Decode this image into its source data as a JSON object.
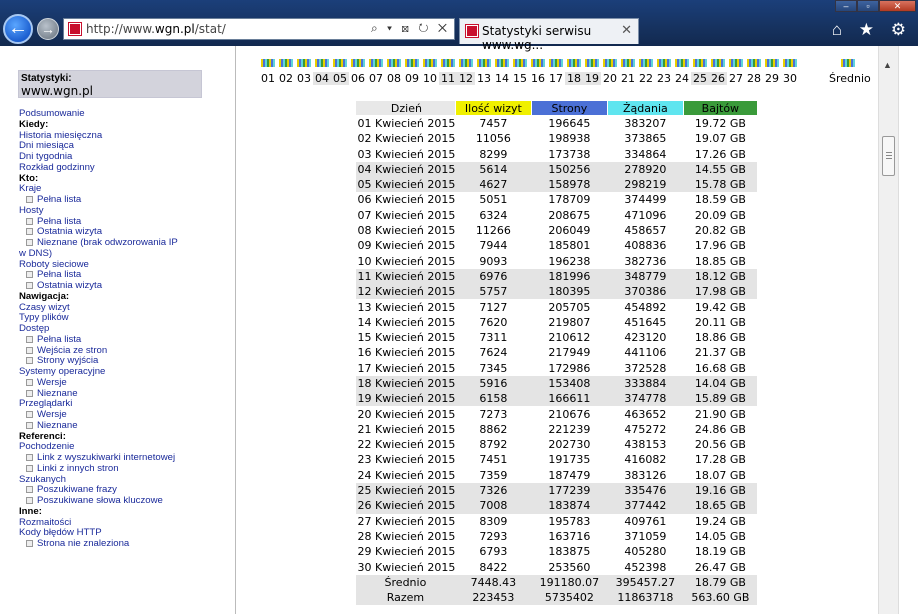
{
  "browser": {
    "url_prefix": "http://www.",
    "url_domain": "wgn.pl",
    "url_path": "/stat/",
    "address_controls": "⌕ ▾ ⊠ ↻ ✕",
    "tab_title": "Statystyki serwisu www.wg...",
    "tab_close": "✕",
    "toolbar_icons": "⌂ ★ ⚙",
    "colors": {
      "chrome": "#16325f",
      "back_button": "#1c5fd0"
    }
  },
  "sidebar": {
    "label": "Statystyki:",
    "site": "www.wgn.pl",
    "menu": [
      {
        "text": "Podsumowanie",
        "type": "link"
      },
      {
        "text": "Kiedy:",
        "type": "head"
      },
      {
        "text": "Historia miesięczna",
        "type": "link"
      },
      {
        "text": "Dni miesiąca",
        "type": "link"
      },
      {
        "text": "Dni tygodnia",
        "type": "link"
      },
      {
        "text": "Rozkład godzinny",
        "type": "link"
      },
      {
        "text": "Kto:",
        "type": "head"
      },
      {
        "text": "Kraje",
        "type": "link"
      },
      {
        "text": "Pełna lista",
        "type": "sub"
      },
      {
        "text": "Hosty",
        "type": "link"
      },
      {
        "text": "Pełna lista",
        "type": "sub"
      },
      {
        "text": "Ostatnia wizyta",
        "type": "sub"
      },
      {
        "text": "Nieznane (brak odwzorowania IP",
        "type": "sub"
      },
      {
        "text": "w DNS)",
        "type": "link"
      },
      {
        "text": "Roboty sieciowe",
        "type": "link"
      },
      {
        "text": "Pełna lista",
        "type": "sub"
      },
      {
        "text": "Ostatnia wizyta",
        "type": "sub"
      },
      {
        "text": "Nawigacja:",
        "type": "head"
      },
      {
        "text": "Czasy wizyt",
        "type": "link"
      },
      {
        "text": "Typy plików",
        "type": "link"
      },
      {
        "text": "Dostęp",
        "type": "link"
      },
      {
        "text": "Pełna lista",
        "type": "sub"
      },
      {
        "text": "Wejścia ze stron",
        "type": "sub"
      },
      {
        "text": "Strony wyjścia",
        "type": "sub"
      },
      {
        "text": "Systemy operacyjne",
        "type": "link"
      },
      {
        "text": "Wersje",
        "type": "sub"
      },
      {
        "text": "Nieznane",
        "type": "sub"
      },
      {
        "text": "Przeglądarki",
        "type": "link"
      },
      {
        "text": "Wersje",
        "type": "sub"
      },
      {
        "text": "Nieznane",
        "type": "sub"
      },
      {
        "text": "Referenci:",
        "type": "head"
      },
      {
        "text": "Pochodzenie",
        "type": "link"
      },
      {
        "text": "Link z wyszukiwarki internetowej",
        "type": "sub"
      },
      {
        "text": "Linki z innych stron",
        "type": "sub"
      },
      {
        "text": "Szukanych",
        "type": "link"
      },
      {
        "text": "Poszukiwane frazy",
        "type": "sub"
      },
      {
        "text": "Poszukiwane słowa kluczowe",
        "type": "sub"
      },
      {
        "text": "Inne:",
        "type": "head"
      },
      {
        "text": "Rozmaitości",
        "type": "link"
      },
      {
        "text": "Kody błędów HTTP",
        "type": "link"
      },
      {
        "text": "Strona nie znaleziona",
        "type": "sub"
      }
    ]
  },
  "days_bar": {
    "days": [
      "01",
      "02",
      "03",
      "04",
      "05",
      "06",
      "07",
      "08",
      "09",
      "10",
      "11",
      "12",
      "13",
      "14",
      "15",
      "16",
      "17",
      "18",
      "19",
      "20",
      "21",
      "22",
      "23",
      "24",
      "25",
      "26",
      "27",
      "28",
      "29",
      "30"
    ],
    "weekend_days": [
      "04",
      "05",
      "11",
      "12",
      "18",
      "19",
      "25",
      "26"
    ],
    "average_label": "Średnio"
  },
  "table": {
    "headers": [
      "Dzień",
      "Ilość wizyt",
      "Strony",
      "Żądania",
      "Bajtów"
    ],
    "header_colors": [
      "#e8e8e8",
      "#f0f000",
      "#4b70d6",
      "#5fe5ef",
      "#3a9a3a"
    ],
    "weekend_row_color": "#e4e4e4",
    "rows": [
      [
        "01 Kwiecień 2015",
        "7457",
        "196645",
        "383207",
        "19.72 GB"
      ],
      [
        "02 Kwiecień 2015",
        "11056",
        "198938",
        "373865",
        "19.07 GB"
      ],
      [
        "03 Kwiecień 2015",
        "8299",
        "173738",
        "334864",
        "17.26 GB"
      ],
      [
        "04 Kwiecień 2015",
        "5614",
        "150256",
        "278920",
        "14.55 GB"
      ],
      [
        "05 Kwiecień 2015",
        "4627",
        "158978",
        "298219",
        "15.78 GB"
      ],
      [
        "06 Kwiecień 2015",
        "5051",
        "178709",
        "374499",
        "18.59 GB"
      ],
      [
        "07 Kwiecień 2015",
        "6324",
        "208675",
        "471096",
        "20.09 GB"
      ],
      [
        "08 Kwiecień 2015",
        "11266",
        "206049",
        "458657",
        "20.82 GB"
      ],
      [
        "09 Kwiecień 2015",
        "7944",
        "185801",
        "408836",
        "17.96 GB"
      ],
      [
        "10 Kwiecień 2015",
        "9093",
        "196238",
        "382736",
        "18.85 GB"
      ],
      [
        "11 Kwiecień 2015",
        "6976",
        "181996",
        "348779",
        "18.12 GB"
      ],
      [
        "12 Kwiecień 2015",
        "5757",
        "180395",
        "370386",
        "17.98 GB"
      ],
      [
        "13 Kwiecień 2015",
        "7127",
        "205705",
        "454892",
        "19.42 GB"
      ],
      [
        "14 Kwiecień 2015",
        "7620",
        "219807",
        "451645",
        "20.11 GB"
      ],
      [
        "15 Kwiecień 2015",
        "7311",
        "210612",
        "423120",
        "18.86 GB"
      ],
      [
        "16 Kwiecień 2015",
        "7624",
        "217949",
        "441106",
        "21.37 GB"
      ],
      [
        "17 Kwiecień 2015",
        "7345",
        "172986",
        "372528",
        "16.68 GB"
      ],
      [
        "18 Kwiecień 2015",
        "5916",
        "153408",
        "333884",
        "14.04 GB"
      ],
      [
        "19 Kwiecień 2015",
        "6158",
        "166611",
        "374778",
        "15.89 GB"
      ],
      [
        "20 Kwiecień 2015",
        "7273",
        "210676",
        "463652",
        "21.90 GB"
      ],
      [
        "21 Kwiecień 2015",
        "8862",
        "221239",
        "475272",
        "24.86 GB"
      ],
      [
        "22 Kwiecień 2015",
        "8792",
        "202730",
        "438153",
        "20.56 GB"
      ],
      [
        "23 Kwiecień 2015",
        "7451",
        "191735",
        "416082",
        "17.28 GB"
      ],
      [
        "24 Kwiecień 2015",
        "7359",
        "187479",
        "383126",
        "18.07 GB"
      ],
      [
        "25 Kwiecień 2015",
        "7326",
        "177239",
        "335476",
        "19.16 GB"
      ],
      [
        "26 Kwiecień 2015",
        "7008",
        "183874",
        "377442",
        "18.65 GB"
      ],
      [
        "27 Kwiecień 2015",
        "8309",
        "195783",
        "409761",
        "19.24 GB"
      ],
      [
        "28 Kwiecień 2015",
        "7293",
        "163716",
        "371059",
        "14.05 GB"
      ],
      [
        "29 Kwiecień 2015",
        "6793",
        "183875",
        "405280",
        "18.19 GB"
      ],
      [
        "30 Kwiecień 2015",
        "8422",
        "253560",
        "452398",
        "26.47 GB"
      ]
    ],
    "weekend_rows": [
      3,
      4,
      10,
      11,
      17,
      18,
      24,
      25
    ],
    "average": [
      "Średnio",
      "7448.43",
      "191180.07",
      "395457.27",
      "18.79 GB"
    ],
    "total": [
      "Razem",
      "223453",
      "5735402",
      "11863718",
      "563.60 GB"
    ]
  }
}
